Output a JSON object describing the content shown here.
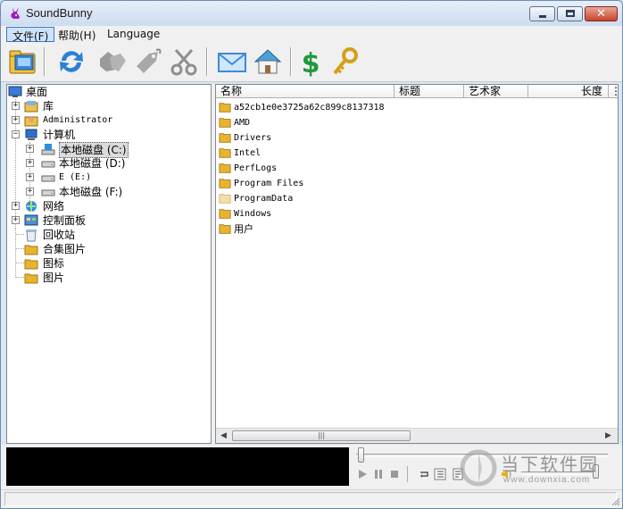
{
  "window": {
    "title": "SoundBunny"
  },
  "menu": [
    {
      "label": "文件(F)"
    },
    {
      "label": "帮助(H)"
    },
    {
      "label": "Language"
    }
  ],
  "toolbar": {
    "buttons": [
      {
        "name": "open-folder",
        "icon": "folder-open-icon"
      },
      {
        "name": "refresh",
        "icon": "refresh-arrows-icon"
      },
      {
        "name": "tag-multi",
        "icon": "tags-icon"
      },
      {
        "name": "tag",
        "icon": "tag-icon"
      },
      {
        "name": "cut",
        "icon": "scissors-icon"
      },
      {
        "name": "email",
        "icon": "envelope-icon"
      },
      {
        "name": "home",
        "icon": "house-icon"
      },
      {
        "name": "buy",
        "icon": "dollar-icon"
      },
      {
        "name": "register",
        "icon": "key-icon"
      }
    ]
  },
  "tree": {
    "desktop": "桌面",
    "library": "库",
    "administrator": "Administrator",
    "computer": "计算机",
    "drive_c": "本地磁盘 (C:)",
    "drive_d": "本地磁盘 (D:)",
    "drive_e": "E (E:)",
    "drive_f": "本地磁盘 (F:)",
    "network": "网络",
    "control_panel": "控制面板",
    "recycle_bin": "回收站",
    "folder1": "合集图片",
    "folder2": "图标",
    "folder3": "图片"
  },
  "list": {
    "columns": [
      "名称",
      "标题",
      "艺术家",
      "长度"
    ],
    "rows": [
      {
        "name": "a52cb1e0e3725a62c899c8137318"
      },
      {
        "name": "AMD"
      },
      {
        "name": "Drivers"
      },
      {
        "name": "Intel"
      },
      {
        "name": "PerfLogs"
      },
      {
        "name": "Program Files"
      },
      {
        "name": "ProgramData"
      },
      {
        "name": "Windows"
      },
      {
        "name": "用户"
      }
    ]
  },
  "player": {
    "seek_position": 0,
    "volume": 0.95
  },
  "watermark": {
    "text": "当下软件园",
    "url": "www.downxia.com"
  },
  "colors": {
    "titlebar": "#cddcf0",
    "display": "#000000",
    "folder": "#e8b32e"
  }
}
